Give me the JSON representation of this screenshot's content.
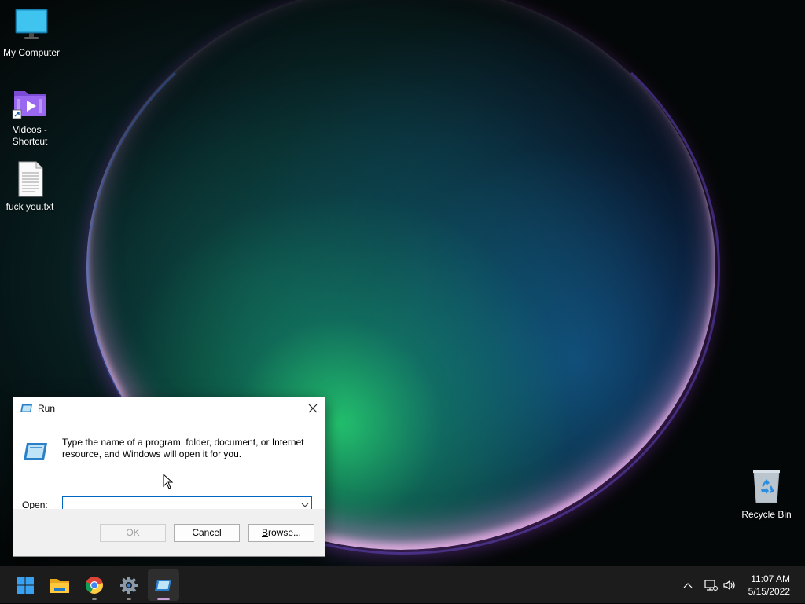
{
  "desktop": {
    "icons": [
      {
        "label": "My Computer",
        "icon": "monitor-icon"
      },
      {
        "label": "Videos - Shortcut",
        "icon": "video-folder-shortcut-icon"
      },
      {
        "label": "fuck you.txt",
        "icon": "text-file-icon"
      },
      {
        "label": "Recycle Bin",
        "icon": "recycle-bin-icon"
      }
    ]
  },
  "run_dialog": {
    "title": "Run",
    "description": "Type the name of a program, folder, document, or Internet resource, and Windows will open it for you.",
    "open_label_prefix": "O",
    "open_label_rest": "pen:",
    "open_value": "",
    "buttons": {
      "ok": "OK",
      "cancel": "Cancel",
      "browse_prefix": "B",
      "browse_rest": "rowse..."
    }
  },
  "taskbar": {
    "apps": [
      {
        "name": "Start",
        "icon": "windows-logo-icon"
      },
      {
        "name": "File Explorer",
        "icon": "folder-icon"
      },
      {
        "name": "Google Chrome",
        "icon": "chrome-icon"
      },
      {
        "name": "Settings",
        "icon": "gear-icon"
      },
      {
        "name": "Run",
        "icon": "run-icon",
        "active": true
      }
    ],
    "clock": {
      "time": "11:07 AM",
      "date": "5/15/2022"
    }
  },
  "colors": {
    "accent": "#0067c0",
    "taskbar": "#1c1c1c",
    "dialog_bg": "#f0f0f0"
  }
}
